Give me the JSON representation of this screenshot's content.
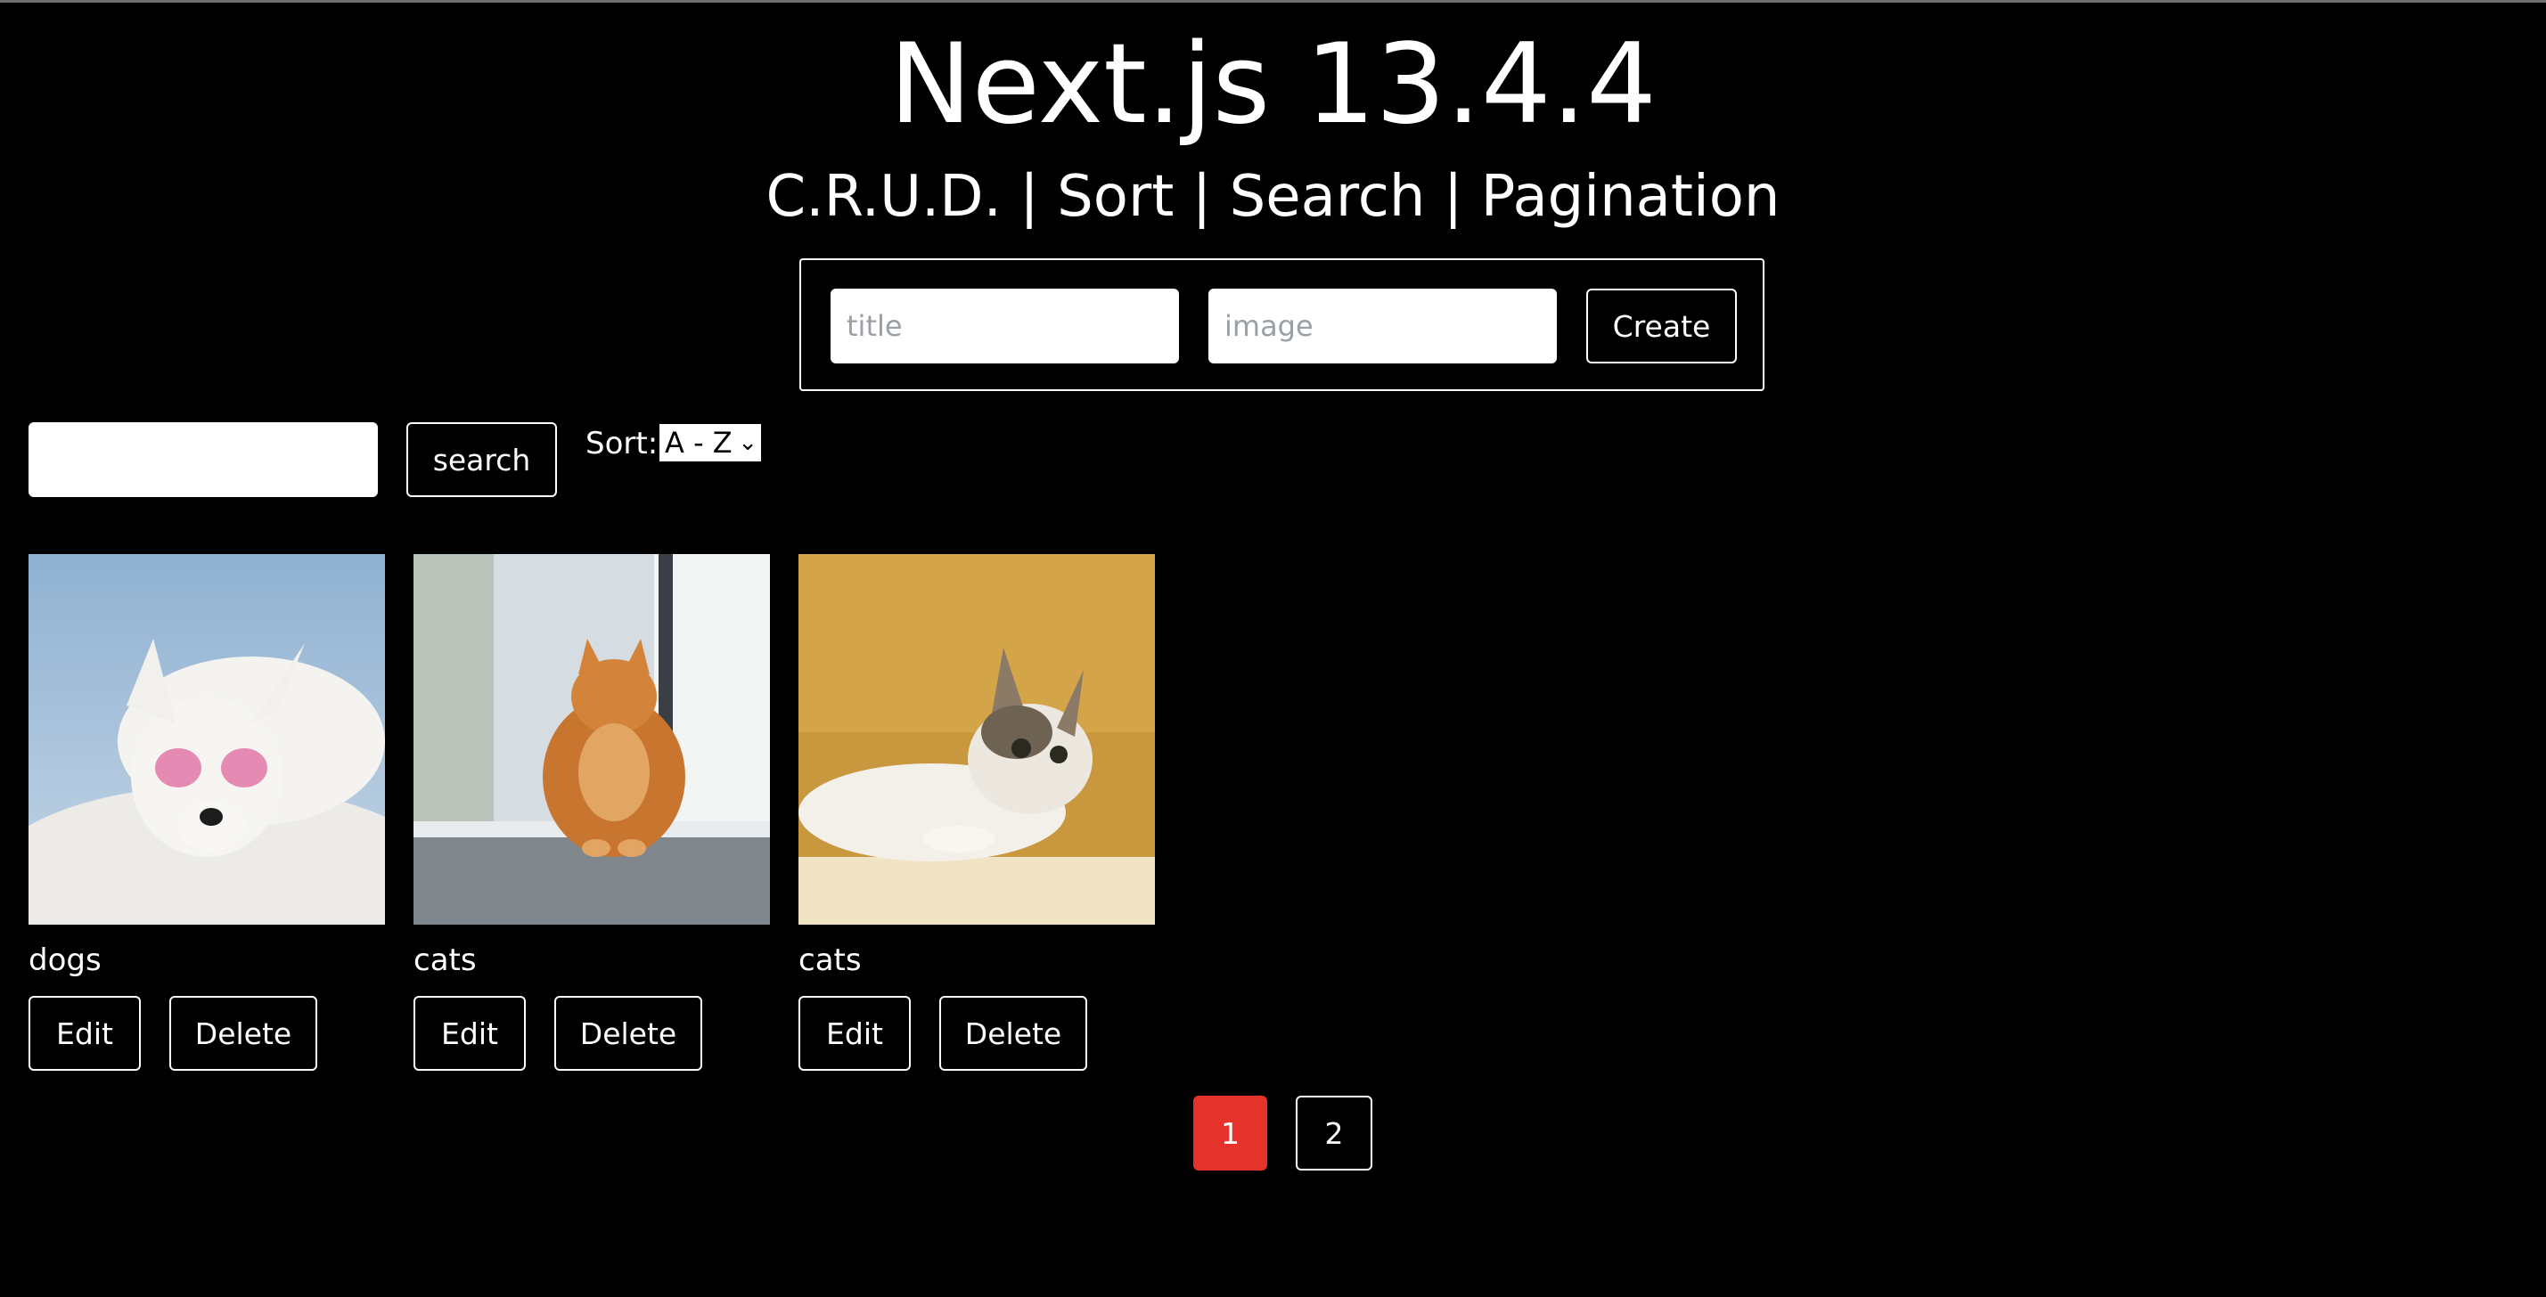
{
  "header": {
    "title": "Next.js 13.4.4",
    "subtitle": "C.R.U.D. | Sort | Search | Pagination"
  },
  "create_form": {
    "title_placeholder": "title",
    "image_placeholder": "image",
    "create_label": "Create"
  },
  "toolbar": {
    "search_value": "",
    "search_label": "search",
    "sort_label": "Sort:",
    "sort_selected": "A - Z"
  },
  "cards": [
    {
      "title": "dogs",
      "edit_label": "Edit",
      "delete_label": "Delete",
      "image": "white dog with pink heart sunglasses"
    },
    {
      "title": "cats",
      "edit_label": "Edit",
      "delete_label": "Delete",
      "image": "orange tabby cat by a window"
    },
    {
      "title": "cats",
      "edit_label": "Edit",
      "delete_label": "Delete",
      "image": "calico kitten on a box"
    }
  ],
  "pagination": {
    "pages": [
      "1",
      "2"
    ],
    "active": "1",
    "active_color": "#e5322b"
  }
}
